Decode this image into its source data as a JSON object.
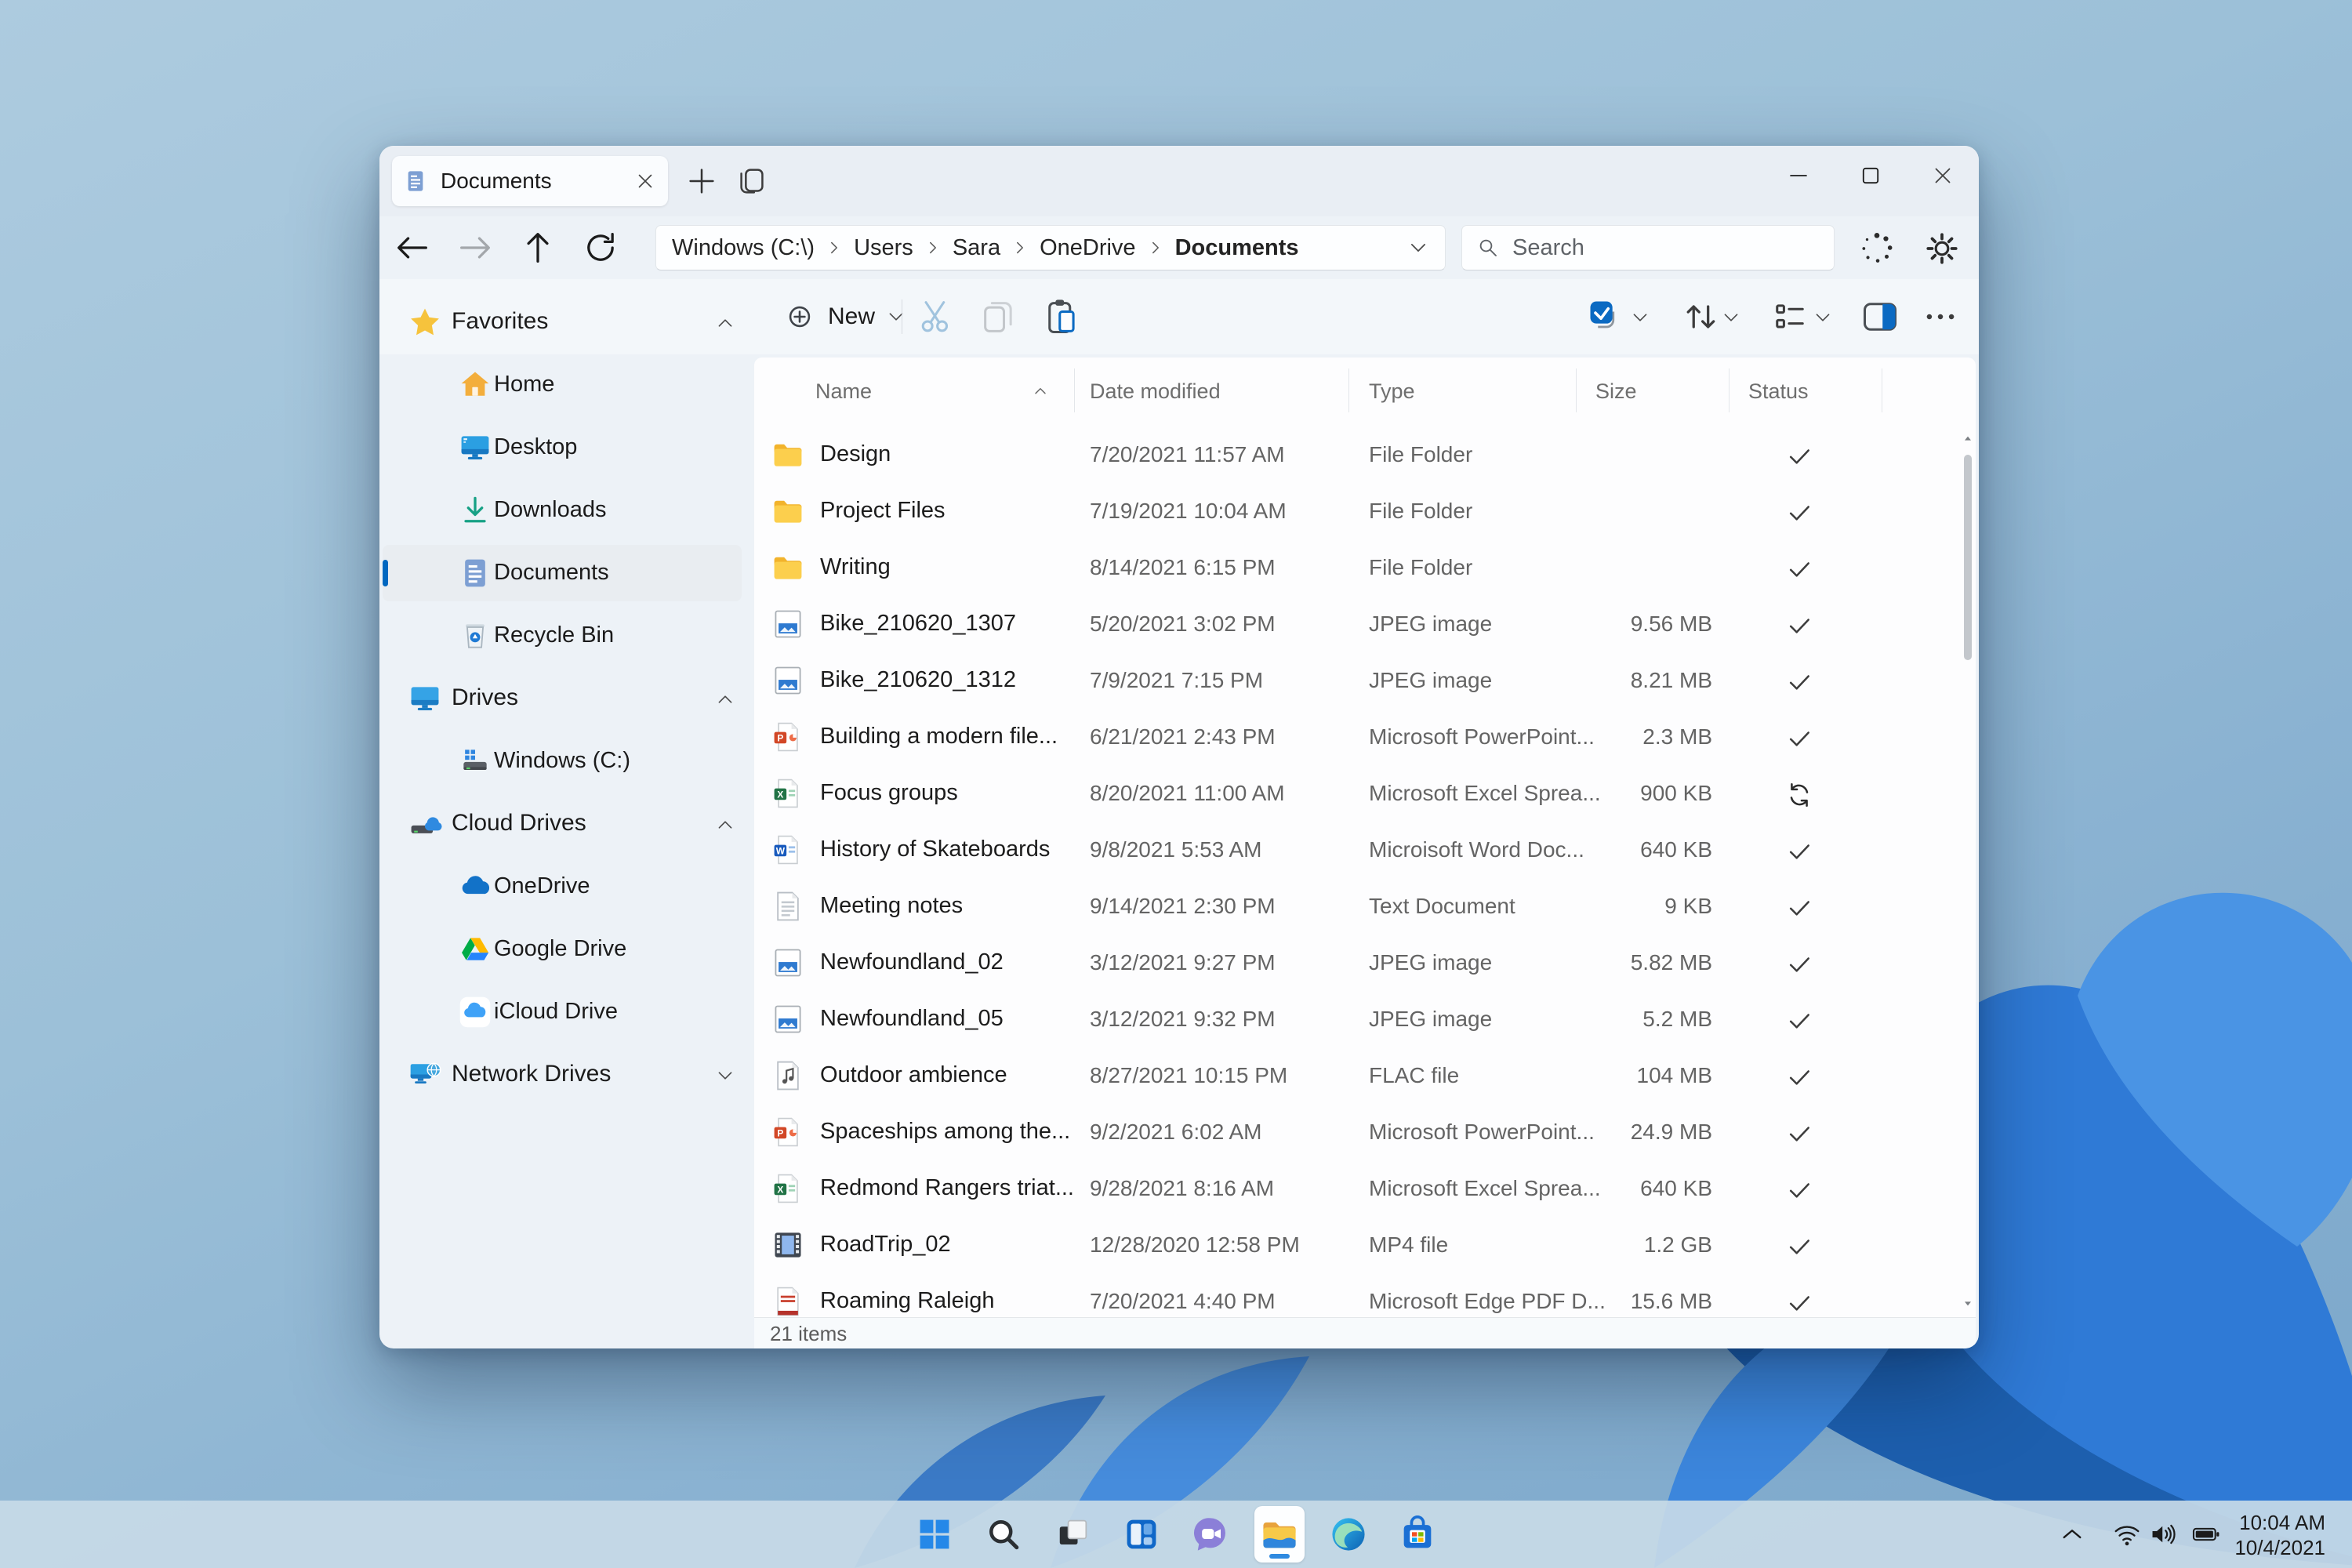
{
  "window": {
    "tab_title": "Documents",
    "controls": [
      "minimize",
      "maximize",
      "close"
    ]
  },
  "address_bar": {
    "breadcrumb": [
      "Windows (C:\\)",
      "Users",
      "Sara",
      "OneDrive",
      "Documents"
    ],
    "search_placeholder": "Search"
  },
  "toolbar": {
    "new_label": "New",
    "left_icons": [
      "cut-scissors",
      "copy-pages",
      "paste-clipboard"
    ],
    "right_icons": [
      "select-checkbox",
      "sort-arrows",
      "view-list",
      "details-pane",
      "see-more-ellipsis"
    ]
  },
  "sidebar": {
    "sections": [
      {
        "label": "Favorites",
        "icon": "star",
        "expanded": true,
        "items": [
          {
            "label": "Home",
            "icon": "home"
          },
          {
            "label": "Desktop",
            "icon": "desktop"
          },
          {
            "label": "Downloads",
            "icon": "download"
          },
          {
            "label": "Documents",
            "icon": "document",
            "selected": true
          },
          {
            "label": "Recycle Bin",
            "icon": "recycle"
          }
        ]
      },
      {
        "label": "Drives",
        "icon": "monitor",
        "expanded": true,
        "items": [
          {
            "label": "Windows (C:)",
            "icon": "hdd"
          }
        ]
      },
      {
        "label": "Cloud Drives",
        "icon": "cloud-drive",
        "expanded": true,
        "items": [
          {
            "label": "OneDrive",
            "icon": "onedrive"
          },
          {
            "label": "Google Drive",
            "icon": "google-drive"
          },
          {
            "label": "iCloud Drive",
            "icon": "icloud"
          }
        ]
      },
      {
        "label": "Network Drives",
        "icon": "network",
        "expanded": false,
        "items": []
      }
    ]
  },
  "filelist": {
    "columns": [
      "Name",
      "Date modified",
      "Type",
      "Size",
      "Status"
    ],
    "sort_column": "Name",
    "rows": [
      {
        "name": "Design",
        "date": "7/20/2021  11:57 AM",
        "type": "File Folder",
        "size": "",
        "status": "synced",
        "icon": "folder"
      },
      {
        "name": "Project Files",
        "date": "7/19/2021  10:04 AM",
        "type": "File Folder",
        "size": "",
        "status": "synced",
        "icon": "folder"
      },
      {
        "name": "Writing",
        "date": "8/14/2021  6:15 PM",
        "type": "File Folder",
        "size": "",
        "status": "synced",
        "icon": "folder"
      },
      {
        "name": "Bike_210620_1307",
        "date": "5/20/2021  3:02 PM",
        "type": "JPEG image",
        "size": "9.56 MB",
        "status": "synced",
        "icon": "jpeg"
      },
      {
        "name": "Bike_210620_1312",
        "date": "7/9/2021  7:15 PM",
        "type": "JPEG image",
        "size": "8.21 MB",
        "status": "synced",
        "icon": "jpeg"
      },
      {
        "name": "Building a modern file...",
        "date": "6/21/2021  2:43 PM",
        "type": "Microsoft PowerPoint...",
        "size": "2.3 MB",
        "status": "synced",
        "icon": "ppt"
      },
      {
        "name": "Focus groups",
        "date": "8/20/2021  11:00 AM",
        "type": "Microsoft Excel Sprea...",
        "size": "900 KB",
        "status": "syncing",
        "icon": "xls"
      },
      {
        "name": "History of Skateboards",
        "date": "9/8/2021  5:53 AM",
        "type": "Microisoft Word Doc...",
        "size": "640 KB",
        "status": "synced",
        "icon": "word"
      },
      {
        "name": "Meeting notes",
        "date": "9/14/2021  2:30 PM",
        "type": "Text Document",
        "size": "9 KB",
        "status": "synced",
        "icon": "txt"
      },
      {
        "name": "Newfoundland_02",
        "date": "3/12/2021  9:27 PM",
        "type": "JPEG image",
        "size": "5.82 MB",
        "status": "synced",
        "icon": "jpeg"
      },
      {
        "name": "Newfoundland_05",
        "date": "3/12/2021  9:32 PM",
        "type": "JPEG image",
        "size": "5.2 MB",
        "status": "synced",
        "icon": "jpeg"
      },
      {
        "name": "Outdoor ambience",
        "date": "8/27/2021  10:15 PM",
        "type": "FLAC file",
        "size": "104 MB",
        "status": "synced",
        "icon": "flac"
      },
      {
        "name": "Spaceships among the...",
        "date": "9/2/2021  6:02 AM",
        "type": "Microsoft PowerPoint...",
        "size": "24.9 MB",
        "status": "synced",
        "icon": "ppt"
      },
      {
        "name": "Redmond Rangers triat...",
        "date": "9/28/2021  8:16 AM",
        "type": "Microsoft Excel Sprea...",
        "size": "640 KB",
        "status": "synced",
        "icon": "xls"
      },
      {
        "name": "RoadTrip_02",
        "date": "12/28/2020  12:58 PM",
        "type": "MP4 file",
        "size": "1.2 GB",
        "status": "synced",
        "icon": "mp4"
      },
      {
        "name": "Roaming Raleigh",
        "date": "7/20/2021  4:40 PM",
        "type": "Microsoft Edge PDF D...",
        "size": "15.6 MB",
        "status": "synced",
        "icon": "pdf"
      }
    ],
    "status_bar": "21 items"
  },
  "taskbar": {
    "items": [
      {
        "icon": "start",
        "label": "start"
      },
      {
        "icon": "taskbar-search",
        "label": "search"
      },
      {
        "icon": "task-view",
        "label": "task-view"
      },
      {
        "icon": "widgets",
        "label": "widgets"
      },
      {
        "icon": "chat",
        "label": "chat"
      },
      {
        "icon": "file-explorer",
        "label": "file-explorer",
        "active": true
      },
      {
        "icon": "edge",
        "label": "edge"
      },
      {
        "icon": "store",
        "label": "store"
      }
    ],
    "tray": {
      "time": "10:04 AM",
      "date": "10/4/2021"
    }
  },
  "colors": {
    "accent": "#0067c0",
    "folder_yellow": "#fccf4d",
    "selection_bg": "#e9edf1"
  }
}
